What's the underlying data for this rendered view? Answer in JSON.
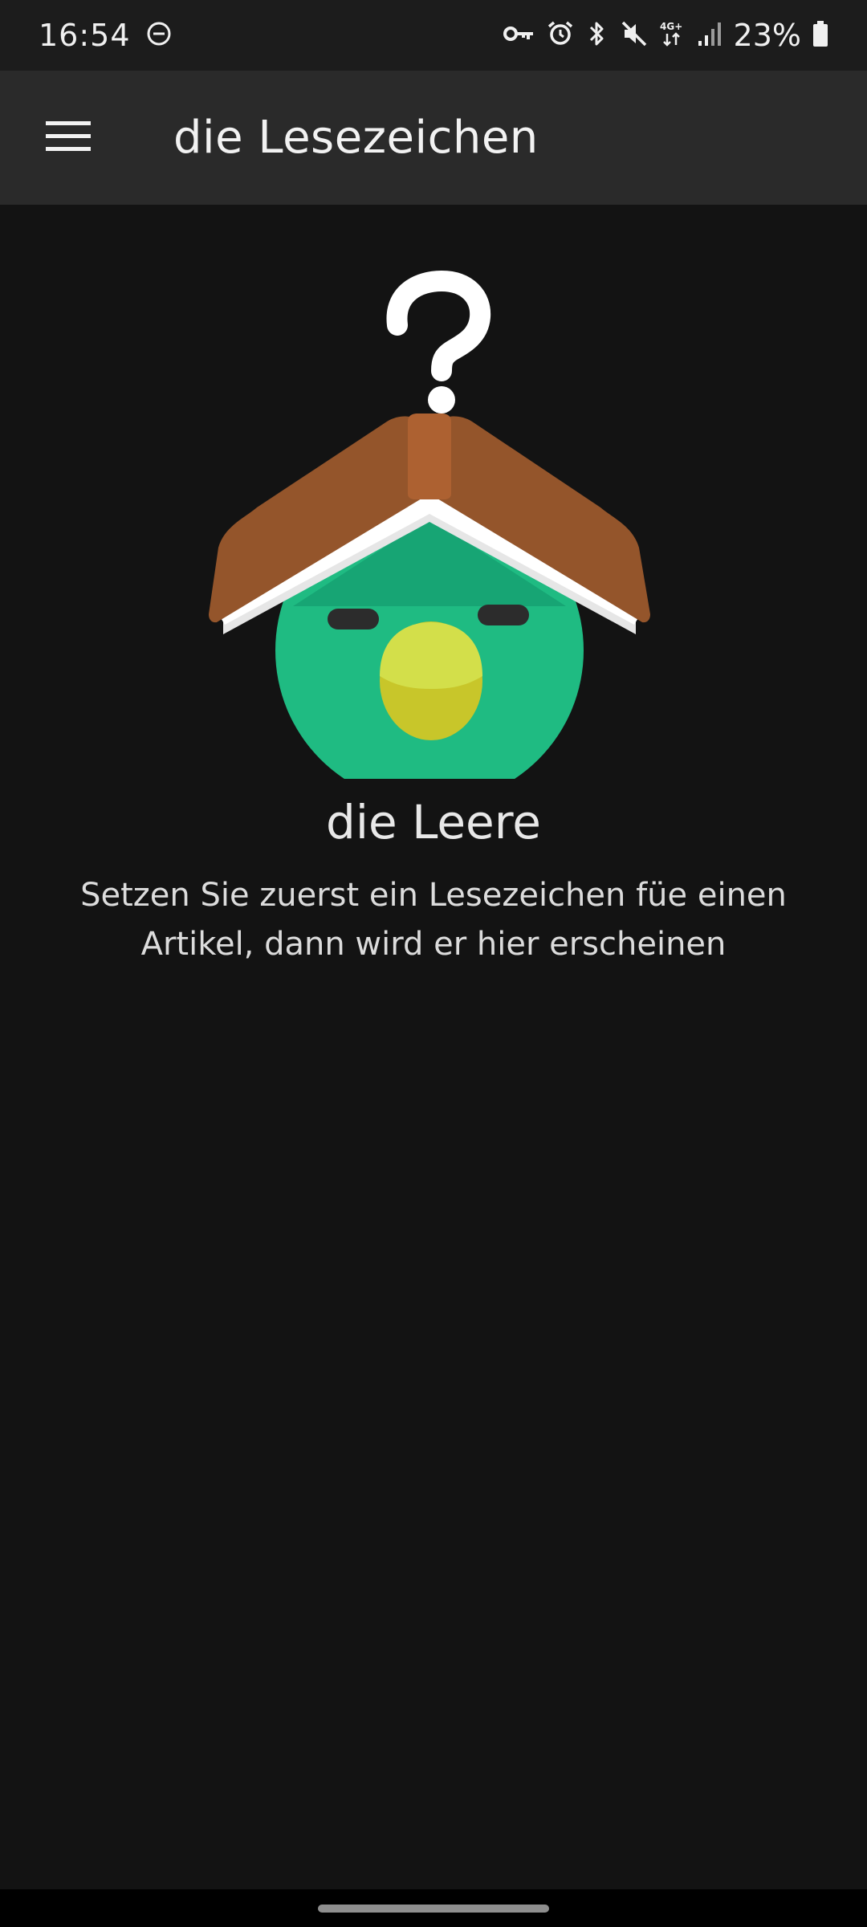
{
  "status_bar": {
    "time": "16:54",
    "battery": "23%",
    "icons": [
      "do-not-disturb-icon",
      "vpn-key-icon",
      "alarm-icon",
      "bluetooth-icon",
      "mute-icon",
      "network-4g-plus-icon",
      "signal-icon",
      "battery-icon"
    ],
    "network_label": "4G+"
  },
  "app_bar": {
    "title": "die Lesezeichen",
    "menu_icon": "hamburger-menu-icon"
  },
  "empty_state": {
    "illustration": "bird-under-book-question-mark",
    "title": "die Leere",
    "message": "Setzen Sie zuerst ein Lesezeichen füe einen Artikel, dann wird er hier erscheinen"
  },
  "colors": {
    "background": "#131313",
    "app_bar": "#2a2a2a",
    "bird_green": "#1fbb82",
    "book_brown": "#94552b",
    "beak_yellow": "#d3df4a"
  }
}
